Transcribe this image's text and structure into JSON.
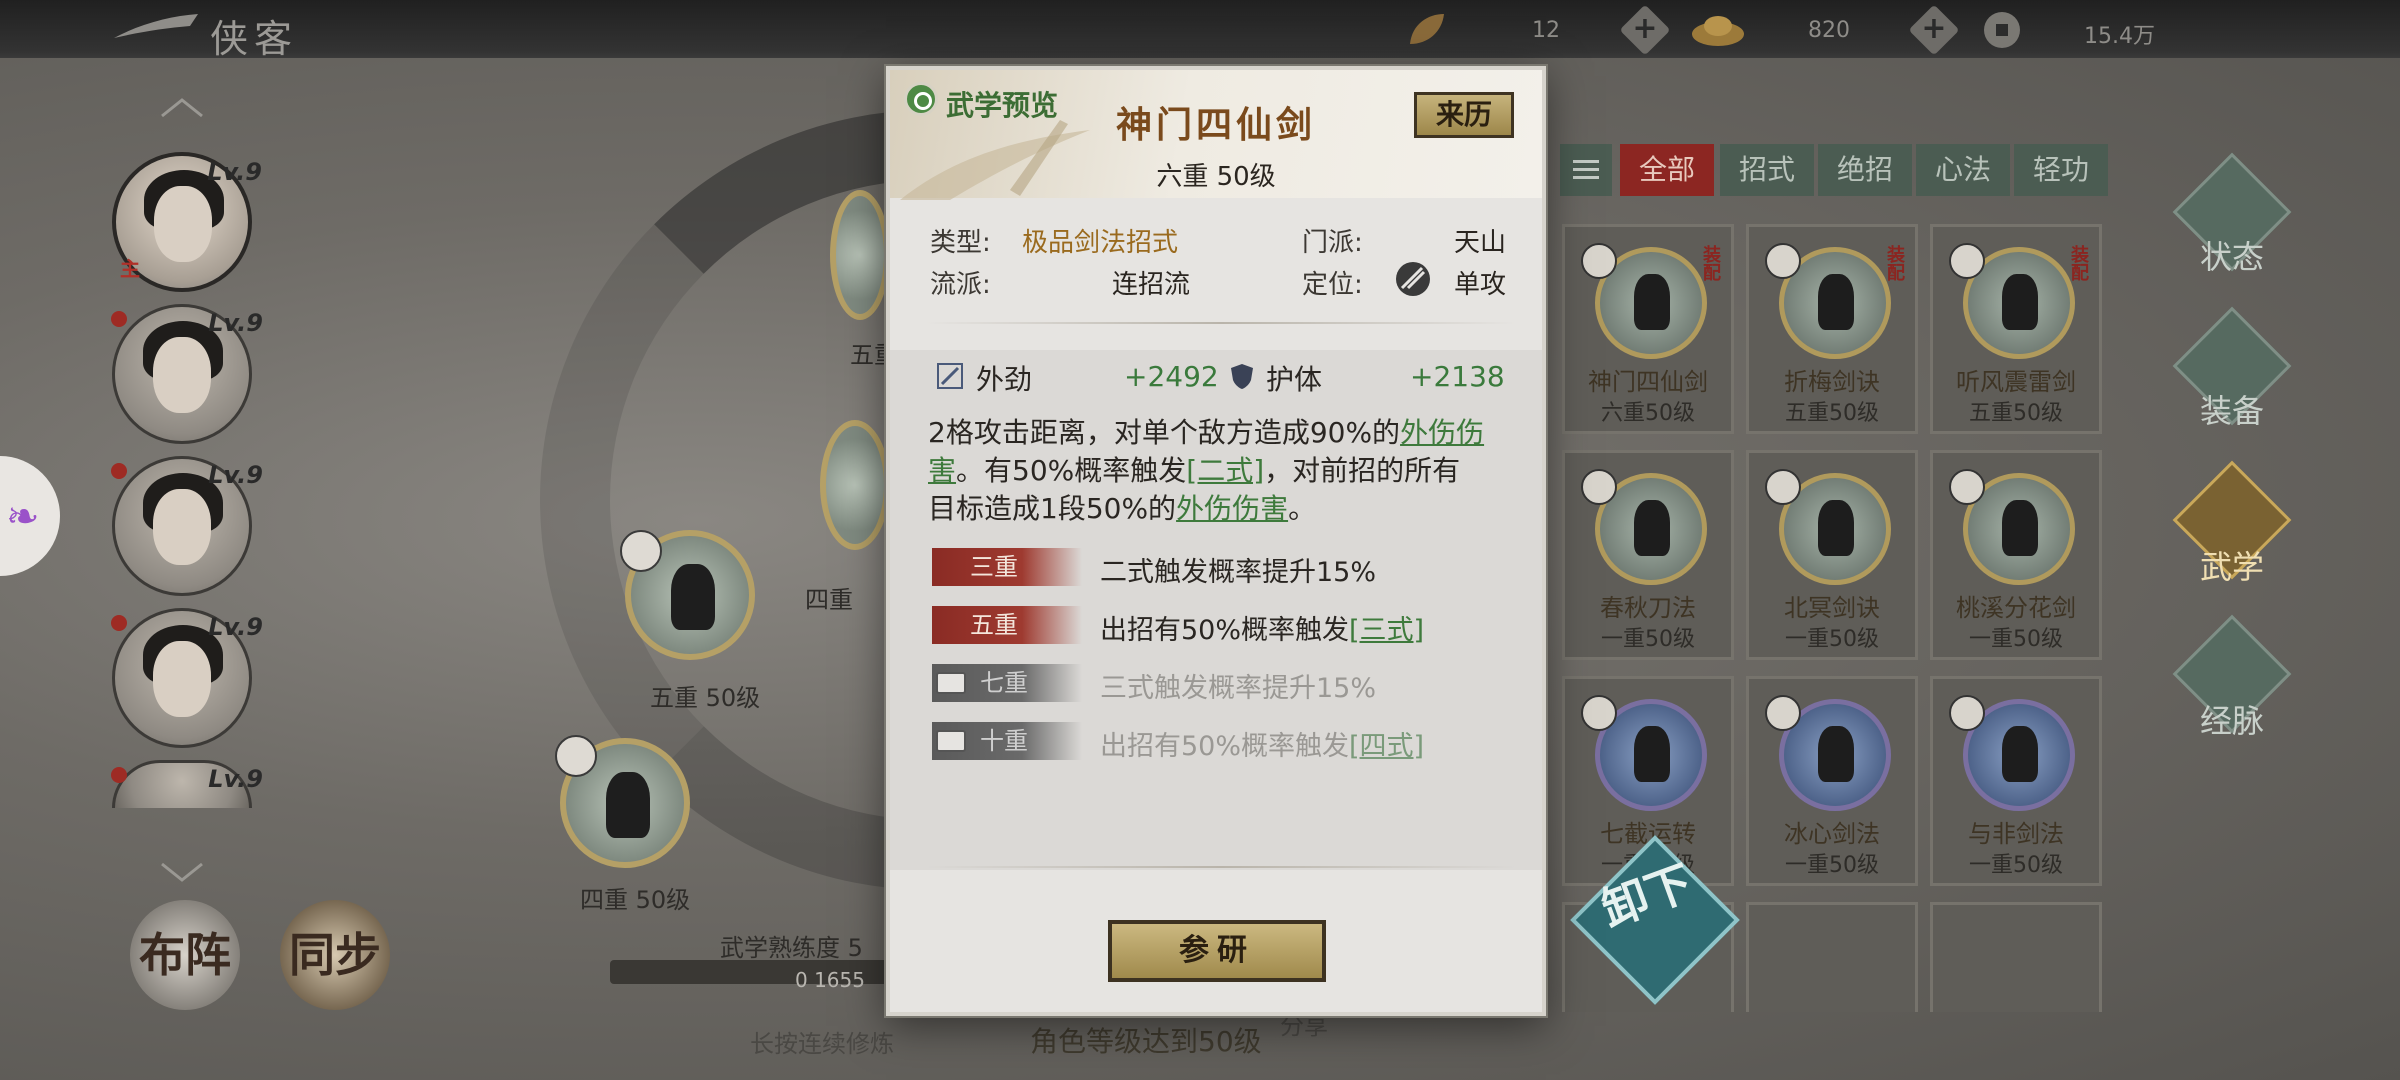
{
  "header": {
    "title": "侠客",
    "resources": [
      {
        "icon": "leaf-icon",
        "value": "12"
      },
      {
        "icon": "gold-ingot-icon",
        "value": "820"
      },
      {
        "icon": "coin-icon",
        "value": "15.4万"
      }
    ]
  },
  "roster": {
    "characters": [
      {
        "level": "Lv.9",
        "tag": "主",
        "active": true
      },
      {
        "level": "Lv.9"
      },
      {
        "level": "Lv.9"
      },
      {
        "level": "Lv.9"
      },
      {
        "level": "Lv.9"
      }
    ]
  },
  "bottom_buttons": {
    "formation": "布阵",
    "sync": "同步"
  },
  "tree": {
    "nodes": [
      {
        "label": "五重"
      },
      {
        "label": "五重 50级"
      },
      {
        "label": "四重"
      },
      {
        "label": "四重 50级"
      }
    ],
    "mastery_label": "武学熟练度 5",
    "mastery_value": "0 1655",
    "hold_hint": "长按连续修炼",
    "requirement": "角色等级达到50级",
    "extra_text": "分享"
  },
  "filters": [
    "全部",
    "招式",
    "绝招",
    "心法",
    "轻功"
  ],
  "cards": [
    {
      "name": "神门四仙剑",
      "level": "六重50级",
      "tag": "装配"
    },
    {
      "name": "折梅剑诀",
      "level": "五重50级",
      "tag": "装配"
    },
    {
      "name": "听风震雷剑",
      "level": "五重50级",
      "tag": "装配"
    },
    {
      "name": "春秋刀法",
      "level": "一重50级"
    },
    {
      "name": "北冥剑诀",
      "level": "一重50级"
    },
    {
      "name": "桃溪分花剑",
      "level": "一重50级"
    },
    {
      "name": "七截运转",
      "level": "一重50级"
    },
    {
      "name": "冰心剑法",
      "level": "一重50级"
    },
    {
      "name": "与非剑法",
      "level": "一重50级"
    }
  ],
  "unload_label": "卸下",
  "right_nav": [
    "状态",
    "装备",
    "武学",
    "经脉"
  ],
  "modal": {
    "preview_label": "武学预览",
    "skill_name": "神门四仙剑",
    "skill_level": "六重 50级",
    "origin_button": "来历",
    "type_key": "类型:",
    "type_val": "极品剑法招式",
    "sect_key": "门派:",
    "sect_val": "天山",
    "school_key": "流派:",
    "school_val": "连招流",
    "role_key": "定位:",
    "role_val": "单攻",
    "stats": [
      {
        "name": "外劲",
        "value": "+2492"
      },
      {
        "name": "护体",
        "value": "+2138"
      }
    ],
    "desc": {
      "p1": "2格攻击距离，对单个敌方造成90%的",
      "h1": "外伤伤害",
      "p2": "。有50%概率触发",
      "h2": "[二式]",
      "p3": "，对前招的所有目标造成1段50%的",
      "h3": "外伤伤害",
      "p4": "。"
    },
    "tiers": [
      {
        "badge": "三重",
        "text": "二式触发概率提升15%",
        "locked": false
      },
      {
        "badge": "五重",
        "text": "出招有50%概率触发",
        "hl": "[三式]",
        "locked": false
      },
      {
        "badge": "七重",
        "text": "三式触发概率提升15%",
        "locked": true
      },
      {
        "badge": "十重",
        "text": "出招有50%概率触发",
        "hl": "[四式]",
        "locked": true
      }
    ],
    "research_button": "参研"
  },
  "colors": {
    "accent_red": "#8c2622",
    "highlight_green": "#3e7a3c",
    "gold": "#9a6a1e"
  }
}
